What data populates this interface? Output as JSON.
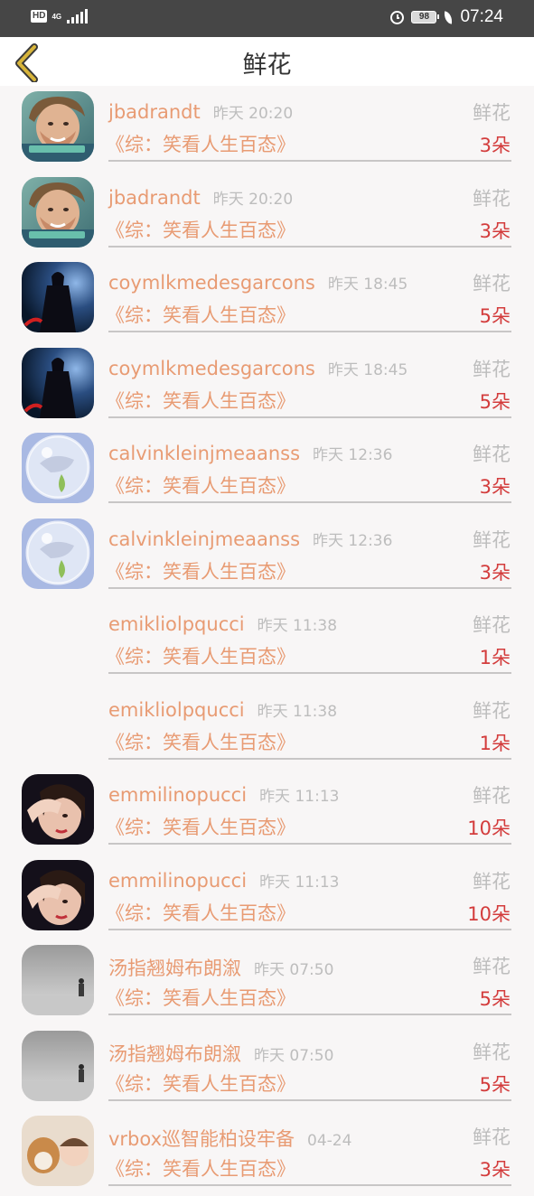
{
  "status_bar": {
    "hd": "HD",
    "network": "4G",
    "battery": "98",
    "time": "07:24"
  },
  "header": {
    "title": "鲜花",
    "back_icon": "chevron-left-icon"
  },
  "colors": {
    "accent": "#e89b73",
    "count": "#d33c3c",
    "muted": "#bdbdbd",
    "back_icon": "#d7b43a"
  },
  "records": [
    {
      "user": "jbadrandt",
      "time": "昨天 20:20",
      "type": "鲜花",
      "book": "《综：笑看人生百态》",
      "count": "3朵",
      "avatar": "man-portrait"
    },
    {
      "user": "jbadrandt",
      "time": "昨天 20:20",
      "type": "鲜花",
      "book": "《综：笑看人生百态》",
      "count": "3朵",
      "avatar": "man-portrait"
    },
    {
      "user": "coymlkmedesgarcons",
      "time": "昨天 18:45",
      "type": "鲜花",
      "book": "《综：笑看人生百态》",
      "count": "5朵",
      "avatar": "dark-figure"
    },
    {
      "user": "coymlkmedesgarcons",
      "time": "昨天 18:45",
      "type": "鲜花",
      "book": "《综：笑看人生百态》",
      "count": "5朵",
      "avatar": "dark-figure"
    },
    {
      "user": "calvinkleinjmeaanss",
      "time": "昨天 12:36",
      "type": "鲜花",
      "book": "《综：笑看人生百态》",
      "count": "3朵",
      "avatar": "crystal-ball"
    },
    {
      "user": "calvinkleinjmeaanss",
      "time": "昨天 12:36",
      "type": "鲜花",
      "book": "《综：笑看人生百态》",
      "count": "3朵",
      "avatar": "crystal-ball"
    },
    {
      "user": "emikliolpqucci",
      "time": "昨天 11:38",
      "type": "鲜花",
      "book": "《综：笑看人生百态》",
      "count": "1朵",
      "avatar": "none"
    },
    {
      "user": "emikliolpqucci",
      "time": "昨天 11:38",
      "type": "鲜花",
      "book": "《综：笑看人生百态》",
      "count": "1朵",
      "avatar": "none"
    },
    {
      "user": "emmilinopucci",
      "time": "昨天 11:13",
      "type": "鲜花",
      "book": "《综：笑看人生百态》",
      "count": "10朵",
      "avatar": "girl-hand"
    },
    {
      "user": "emmilinopucci",
      "time": "昨天 11:13",
      "type": "鲜花",
      "book": "《综：笑看人生百态》",
      "count": "10朵",
      "avatar": "girl-hand"
    },
    {
      "user": "汤指翘姆布朗溆",
      "time": "昨天 07:50",
      "type": "鲜花",
      "book": "《综：笑看人生百态》",
      "count": "5朵",
      "avatar": "gray-room"
    },
    {
      "user": "汤指翘姆布朗溆",
      "time": "昨天 07:50",
      "type": "鲜花",
      "book": "《综：笑看人生百态》",
      "count": "5朵",
      "avatar": "gray-room"
    },
    {
      "user": "vrbox巡智能柏设牢备",
      "time": "04-24",
      "type": "鲜花",
      "book": "《综：笑看人生百态》",
      "count": "3朵",
      "avatar": "dog-baby"
    }
  ]
}
